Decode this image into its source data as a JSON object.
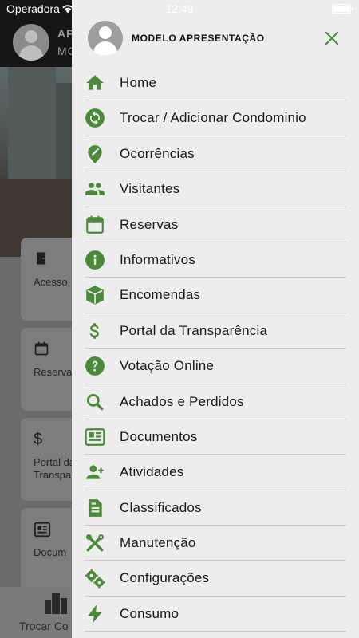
{
  "status_bar": {
    "carrier": "Operadora",
    "time": "12:49"
  },
  "background": {
    "header_name_line1": "AP",
    "header_name_line2": "MC",
    "cards": [
      {
        "icon": "door-icon",
        "label": "Acesso"
      },
      {
        "icon": "calendar-icon",
        "label": "Reservas"
      },
      {
        "icon": "dollar-icon",
        "label": "Portal da\nTranspa"
      },
      {
        "icon": "document-icon",
        "label": "Docum"
      }
    ],
    "footer_label": "Trocar Co"
  },
  "drawer": {
    "user_name": "MODELO APRESENTAÇÃO",
    "accent_color": "#4a8a3a",
    "items": [
      {
        "label": "Home",
        "icon": "home-icon"
      },
      {
        "label": "Trocar / Adicionar Condominio",
        "icon": "sync-icon"
      },
      {
        "label": "Ocorrências",
        "icon": "pin-edit-icon"
      },
      {
        "label": "Visitantes",
        "icon": "people-icon"
      },
      {
        "label": "Reservas",
        "icon": "calendar-icon"
      },
      {
        "label": "Informativos",
        "icon": "info-icon"
      },
      {
        "label": "Encomendas",
        "icon": "package-icon"
      },
      {
        "label": "Portal da Transparência",
        "icon": "dollar-icon"
      },
      {
        "label": "Votação Online",
        "icon": "help-icon"
      },
      {
        "label": "Achados e Perdidos",
        "icon": "search-icon"
      },
      {
        "label": "Documentos",
        "icon": "newspaper-icon"
      },
      {
        "label": "Atividades",
        "icon": "person-add-icon"
      },
      {
        "label": "Classificados",
        "icon": "classified-icon"
      },
      {
        "label": "Manutenção",
        "icon": "tools-icon"
      },
      {
        "label": "Configurações",
        "icon": "gears-icon"
      },
      {
        "label": "Consumo",
        "icon": "bolt-icon"
      }
    ]
  }
}
